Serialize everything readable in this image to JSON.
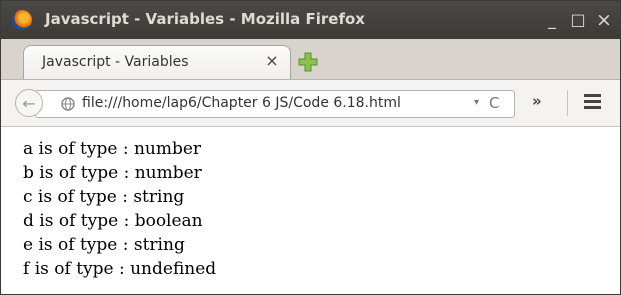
{
  "window": {
    "title": "Javascript - Variables - Mozilla Firefox",
    "minimize_label": "_",
    "maximize_label": "□",
    "close_label": "×"
  },
  "tabs": [
    {
      "label": "Javascript - Variables",
      "close_label": "×",
      "active": true
    }
  ],
  "navbar": {
    "back_label": "←",
    "url": "file:///home/lap6/Chapter 6 JS/Code 6.18.html",
    "dropdown_label": "▾",
    "reload_label": "C",
    "overflow_label": "»"
  },
  "content": {
    "lines": [
      "a is of type : number",
      "b is of type : number",
      "c is of type : string",
      "d is of type : boolean",
      "e is of type : string",
      "f is of type : undefined"
    ]
  },
  "colors": {
    "titlebar": "#3c3b37",
    "title_text": "#dfdbd2",
    "tabstrip": "#d8d4cd",
    "navbar": "#f4f3f1",
    "newtab_plus": "#7cb342"
  },
  "icons": {
    "app": "firefox-icon",
    "newtab": "plus-icon",
    "site": "globe-icon",
    "menu": "hamburger-icon"
  }
}
